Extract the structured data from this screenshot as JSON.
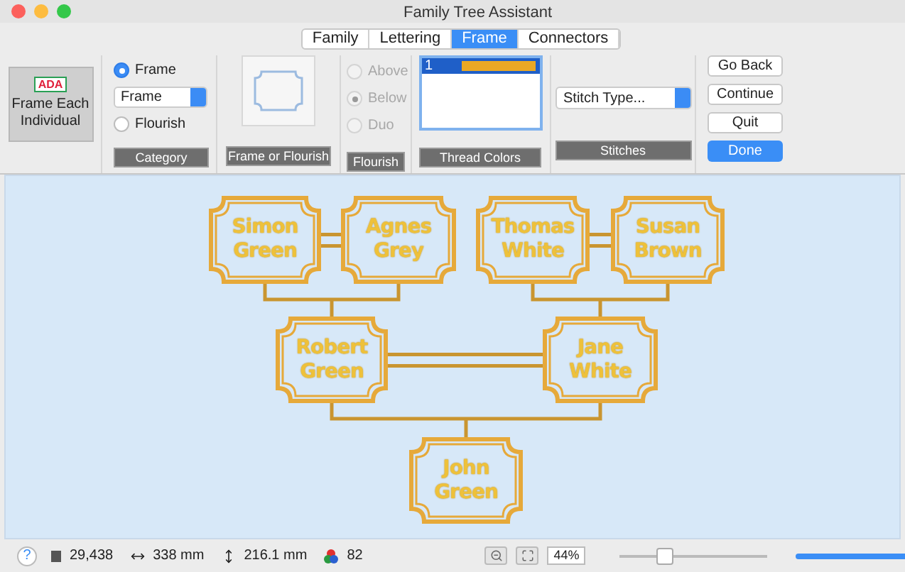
{
  "window": {
    "title": "Family Tree Assistant"
  },
  "tabs": [
    {
      "label": "Family",
      "selected": false
    },
    {
      "label": "Lettering",
      "selected": false
    },
    {
      "label": "Frame",
      "selected": true
    },
    {
      "label": "Connectors",
      "selected": false
    }
  ],
  "toolbar": {
    "frame_each": {
      "icon_text": "ADA",
      "label": "Frame Each Individual",
      "selected": true
    },
    "category": {
      "radios": [
        {
          "label": "Frame",
          "selected": true
        },
        {
          "label": "Flourish",
          "selected": false
        }
      ],
      "select_value": "Frame",
      "caption": "Category"
    },
    "preview": {
      "caption": "Frame or Flourish"
    },
    "flourish": {
      "radios": [
        {
          "label": "Above",
          "selected": false,
          "disabled": true
        },
        {
          "label": "Below",
          "selected": true,
          "disabled": true
        },
        {
          "label": "Duo",
          "selected": false,
          "disabled": true
        }
      ],
      "caption": "Flourish"
    },
    "thread_colors": {
      "items": [
        {
          "label": "1",
          "selected": true,
          "color": "#eaa824"
        }
      ],
      "caption": "Thread Colors"
    },
    "stitches": {
      "select_value": "Stitch Type...",
      "caption": "Stitches"
    },
    "buttons": [
      {
        "label": "Go Back",
        "kind": "normal"
      },
      {
        "label": "Continue",
        "kind": "normal"
      },
      {
        "label": "Quit",
        "kind": "normal"
      },
      {
        "label": "Done",
        "kind": "primary"
      }
    ]
  },
  "tree": {
    "people": [
      {
        "name": "Simon Green"
      },
      {
        "name": "Agnes Grey"
      },
      {
        "name": "Thomas White"
      },
      {
        "name": "Susan Brown"
      },
      {
        "name": "Robert Green"
      },
      {
        "name": "Jane White"
      },
      {
        "name": "John Green"
      }
    ]
  },
  "status": {
    "help": "?",
    "stitch_count": "29,438",
    "width": "338 mm",
    "height": "216.1 mm",
    "color_count": "82",
    "zoom": "44%",
    "zoom_slider": {
      "level": 0.3
    },
    "progress": {
      "level": 1
    }
  }
}
